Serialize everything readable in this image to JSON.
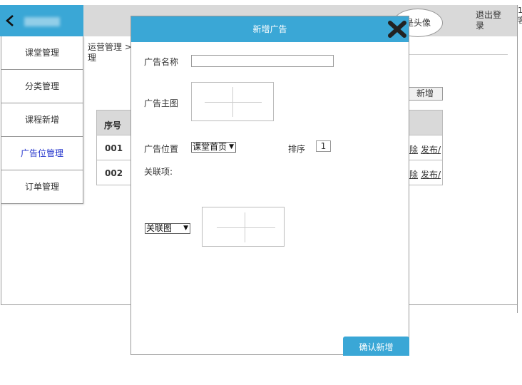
{
  "topbar": {
    "avatar_label": "是头像",
    "logout_label": "退出登录",
    "edge_text": "1 客"
  },
  "sidebar": {
    "items": [
      {
        "label": "课堂管理"
      },
      {
        "label": "分类管理"
      },
      {
        "label": "课程新增"
      },
      {
        "label": "广告位管理"
      },
      {
        "label": "订单管理"
      }
    ]
  },
  "main": {
    "breadcrumb": "运营管理 > 理",
    "add_label": "新增",
    "table": {
      "header": "序号",
      "rows": [
        {
          "id": "001",
          "action1": "除",
          "action2": "发布/"
        },
        {
          "id": "002",
          "action1": "除",
          "action2": "发布/"
        }
      ]
    }
  },
  "modal": {
    "title": "新增广告",
    "name_label": "广告名称",
    "name_value": "",
    "image_label": "广告主图",
    "position_label": "广告位置",
    "position_value": "课堂首页",
    "sort_label": "排序",
    "sort_value": "1",
    "related_label": "关联项:",
    "related_select": "关联图",
    "confirm_label": "确认新增"
  },
  "colors": {
    "accent": "#3aa7d6",
    "active_link": "#2233cc",
    "header_gray": "#d9d9d9"
  },
  "icons": {
    "back": "chevron-left-icon",
    "close": "close-x-icon",
    "image_placeholder": "crosshair-icon"
  }
}
